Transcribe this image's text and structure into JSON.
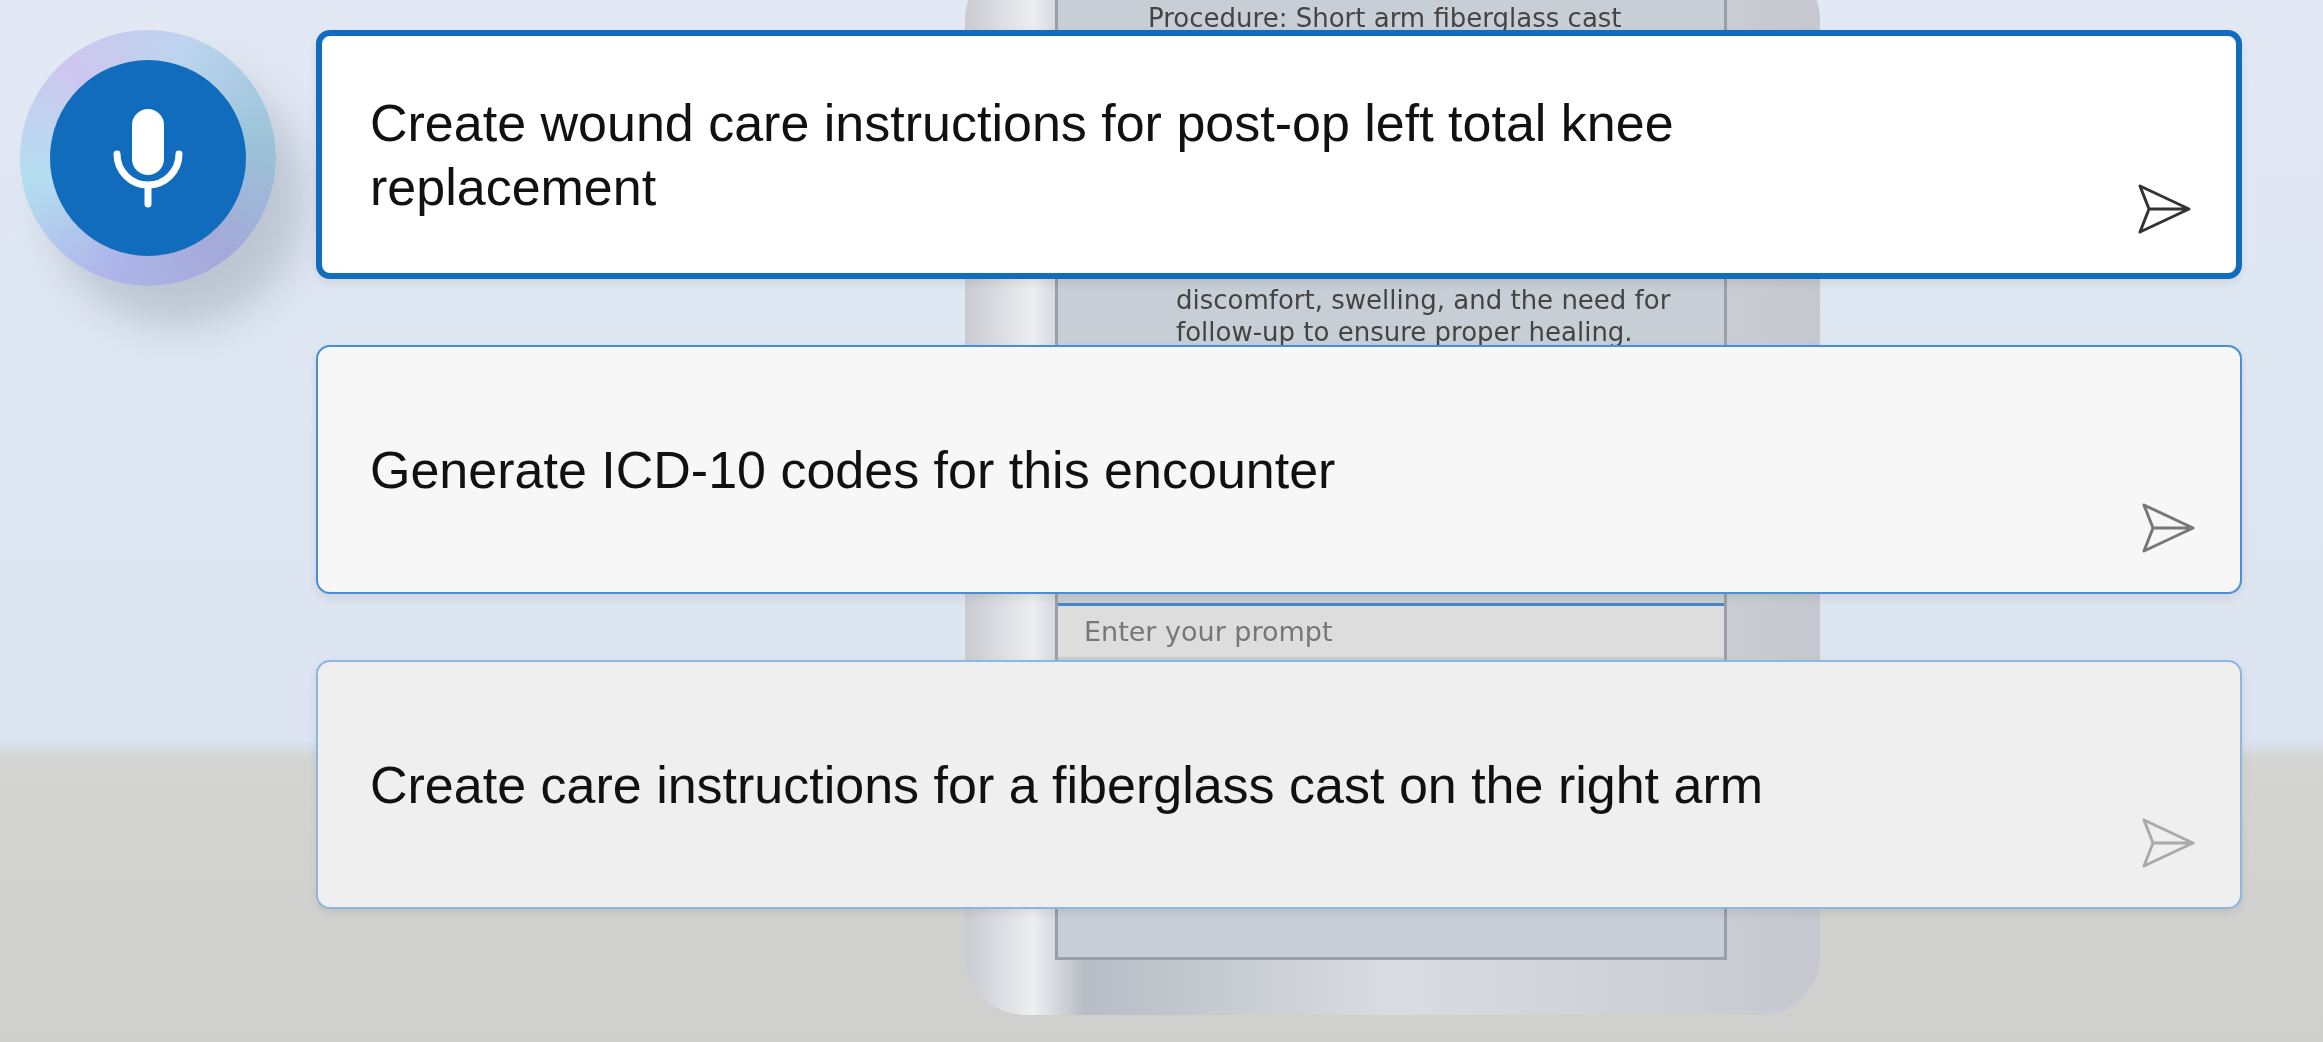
{
  "background_phone": {
    "note_lines": [
      "Procedure: Short arm fiberglass cast",
      "discomfort, swelling, and the need for",
      "follow-up to ensure proper healing."
    ],
    "prompt_field": {
      "placeholder": "Enter your prompt"
    }
  },
  "mic_button": {
    "active": true
  },
  "suggestions": [
    {
      "text": "Create wound care instructions for post-op left total knee replacement",
      "selected": true
    },
    {
      "text": "Generate ICD-10 codes for this encounter",
      "selected": false
    },
    {
      "text": "Create care instructions for a fiberglass cast on the right arm",
      "selected": false
    }
  ]
}
